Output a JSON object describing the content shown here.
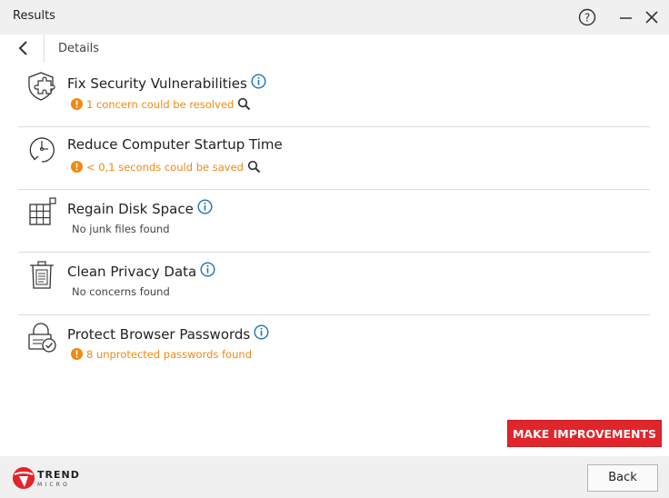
{
  "window": {
    "title": "Results"
  },
  "header": {
    "section_title": "Details"
  },
  "items": [
    {
      "name": "Fix Security Vulnerabilities",
      "status": "1 concern could be resolved",
      "status_type": "warning",
      "icon": "shield-puzzle-icon"
    },
    {
      "name": "Reduce Computer Startup Time",
      "status": "< 0,1 seconds could be saved",
      "status_type": "warning",
      "icon": "clock-icon"
    },
    {
      "name": "Regain Disk Space",
      "status": "No junk files found",
      "status_type": "ok",
      "icon": "disk-grid-icon"
    },
    {
      "name": "Clean Privacy Data",
      "status": "No concerns found",
      "status_type": "ok",
      "icon": "trash-document-icon"
    },
    {
      "name": "Protect Browser Passwords",
      "status": "8 unprotected passwords found",
      "status_type": "warning",
      "icon": "lock-check-icon"
    }
  ],
  "actions": {
    "make_improvements": "MAKE IMPROVEMENTS",
    "back": "Back"
  },
  "brand": {
    "line1": "TREND",
    "line2": "MICRO"
  },
  "colors": {
    "accent_red": "#e0252b",
    "warning_orange": "#ef8a10",
    "info_blue": "#1a73b8"
  }
}
